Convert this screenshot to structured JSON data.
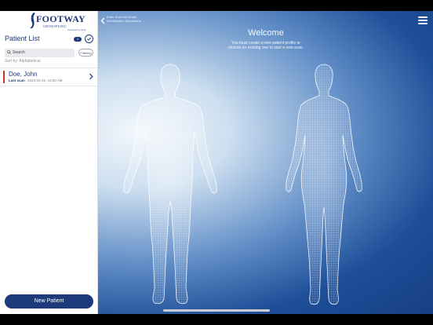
{
  "brand": {
    "name": "FOOTWAY",
    "tagline": "ORTHOPEDIC",
    "powered": "Powered by Scan"
  },
  "sidebar": {
    "title": "Patient List",
    "count": "1",
    "search_placeholder": "Search",
    "filter_label": "Filtering",
    "sort_label": "Sort by: Alphabetical",
    "patients": [
      {
        "name": "Doe, John",
        "scan_label": "Last scan",
        "scan_date": "2023-04-25, 10:02 AM"
      }
    ],
    "new_patient_label": "New Patient"
  },
  "main": {
    "back_text": "Enter Scan No Model Identification Nymbolous",
    "welcome_title": "Welcome",
    "welcome_text": "You must create a new patient profile or choose an existing one to start a new scan."
  },
  "colors": {
    "brand": "#1d3a7a",
    "flag": "#c0392b"
  }
}
